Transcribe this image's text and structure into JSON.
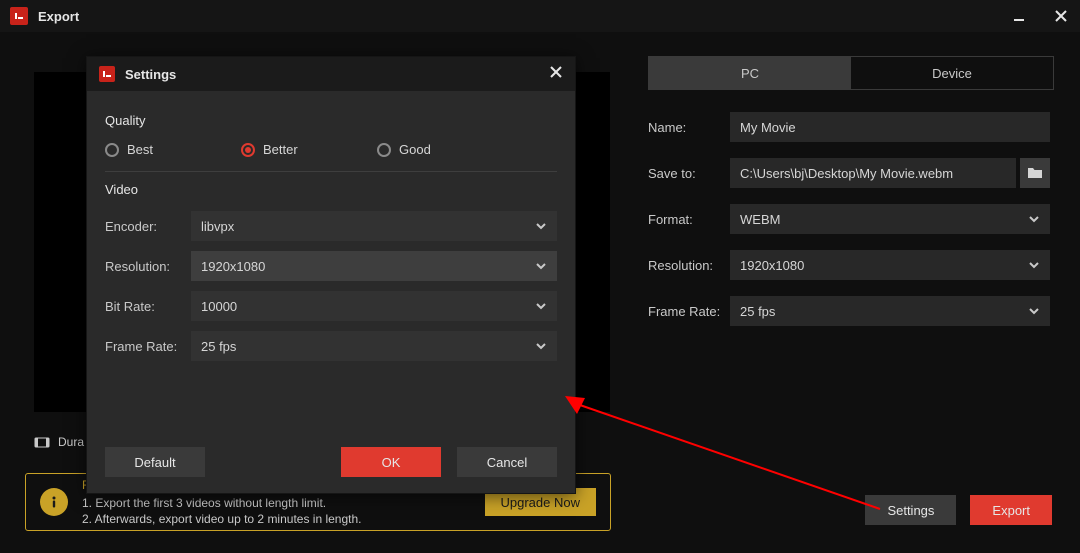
{
  "titlebar": {
    "text": "Export"
  },
  "duration_label": "Dura",
  "tabs": {
    "pc": "PC",
    "device": "Device",
    "active": "pc"
  },
  "main": {
    "name_lbl": "Name:",
    "name_val": "My Movie",
    "saveto_lbl": "Save to:",
    "saveto_val": "C:\\Users\\bj\\Desktop\\My Movie.webm",
    "format_lbl": "Format:",
    "format_val": "WEBM",
    "resolution_lbl": "Resolution:",
    "resolution_val": "1920x1080",
    "framerate_lbl": "Frame Rate:",
    "framerate_val": "25 fps"
  },
  "buttons": {
    "settings": "Settings",
    "export": "Export"
  },
  "banner": {
    "title": "Free Edition Limitations:",
    "line1": "1. Export the first 3 videos without length limit.",
    "line2": "2. Afterwards, export video up to 2 minutes in length.",
    "upgrade": "Upgrade Now"
  },
  "dialog": {
    "title": "Settings",
    "quality_title": "Quality",
    "quality_options": {
      "best": "Best",
      "better": "Better",
      "good": "Good",
      "selected": "better"
    },
    "video_title": "Video",
    "encoder_lbl": "Encoder:",
    "encoder_val": "libvpx",
    "resolution_lbl": "Resolution:",
    "resolution_val": "1920x1080",
    "bitrate_lbl": "Bit Rate:",
    "bitrate_val": "10000",
    "framerate_lbl": "Frame Rate:",
    "framerate_val": "25 fps",
    "default_btn": "Default",
    "ok_btn": "OK",
    "cancel_btn": "Cancel"
  }
}
